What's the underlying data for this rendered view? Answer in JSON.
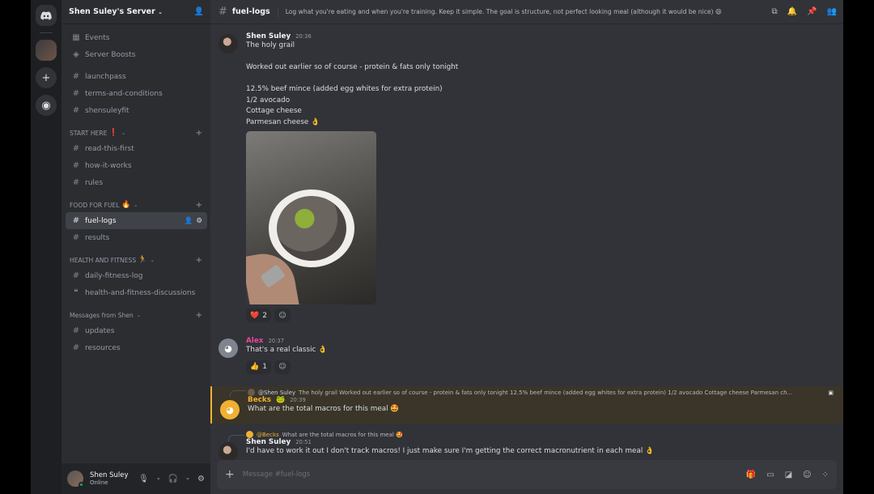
{
  "server": {
    "name": "Shen Suley's Server",
    "top_items": [
      {
        "icon": "calendar-icon",
        "glyph": "▦",
        "label": "Events"
      },
      {
        "icon": "boost-icon",
        "glyph": "◈",
        "label": "Server Boosts"
      }
    ]
  },
  "channels_ungrouped": [
    "launchpass",
    "terms-and-conditions",
    "shensuleyfit"
  ],
  "categories": [
    {
      "name": "START HERE",
      "emoji": "❗",
      "channels": [
        "read-this-first",
        "how-it-works",
        "rules"
      ]
    },
    {
      "name": "FOOD FOR FUEL",
      "emoji": "🔥",
      "channels": [
        "fuel-logs",
        "results"
      ]
    },
    {
      "name": "HEALTH AND FITNESS",
      "emoji": "🏃",
      "channels": [
        "daily-fitness-log",
        "health-and-fitness-discussions"
      ]
    },
    {
      "name": "Messages from Shen",
      "emoji": "",
      "channels": [
        "updates",
        "resources"
      ]
    }
  ],
  "user": {
    "name": "Shen Suley",
    "status": "Online"
  },
  "channel_header": {
    "name": "fuel-logs",
    "topic": "Log what you're eating and when you're training. Keep it simple. The goal is structure, not perfect looking meal (although it would be nice) 😄"
  },
  "messages": [
    {
      "author": "Shen Suley",
      "time": "20:36",
      "lines": [
        "The holy grail",
        "",
        "Worked out earlier so of course - protein & fats only tonight",
        "",
        "12.5% beef mince (added egg whites for extra protein)",
        "1/2 avocado",
        "Cottage cheese",
        "Parmesan cheese 👌"
      ],
      "reactions": [
        {
          "emoji": "❤️",
          "count": "2"
        }
      ]
    },
    {
      "author": "Alex",
      "time": "20:37",
      "lines": [
        "That's a real classic 👌"
      ],
      "reactions": [
        {
          "emoji": "👍",
          "count": "1"
        }
      ]
    },
    {
      "reply_to_author": "@Shen Suley",
      "reply_to_text": "The holy grail  Worked out earlier so of course - protein & fats only tonight  12.5% beef mince (added egg whites for extra protein) 1/2 avocado  Cottage cheese  Parmesan ch...",
      "author": "Becks",
      "author_badge": "🐸",
      "time": "20:39",
      "lines": [
        "What are the total macros for this meal 🤩"
      ]
    },
    {
      "reply_to_author": "@Becks",
      "reply_to_text": "What are the total macros for this meal 🤩",
      "author": "Shen Suley",
      "time": "20:51",
      "lines": [
        "I'd have to work it out I don't track macros! I just make sure I'm getting the correct macronutrient in each meal 👌"
      ]
    }
  ],
  "composer": {
    "placeholder": "Message #fuel-logs"
  },
  "colors": {
    "alex": "#eb459e",
    "becks": "#f0b132",
    "accent": "#5865f2"
  }
}
